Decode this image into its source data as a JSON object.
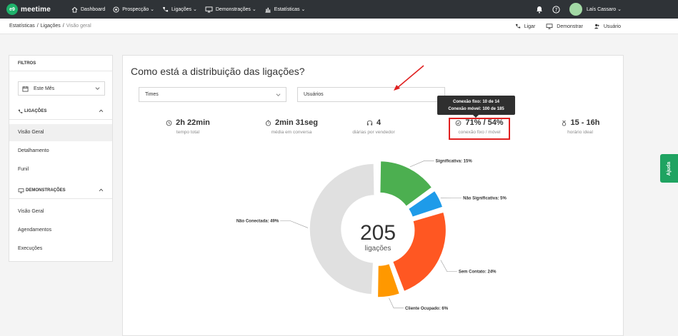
{
  "nav": {
    "logo_mark": "e9",
    "logo_text": "meetime",
    "items": [
      {
        "label": "Dashboard",
        "icon": "home-icon"
      },
      {
        "label": "Prospecção ⌄",
        "icon": "target-icon"
      },
      {
        "label": "Ligações ⌄",
        "icon": "phone-icon"
      },
      {
        "label": "Demonstrações ⌄",
        "icon": "monitor-icon"
      },
      {
        "label": "Estatísticas ⌄",
        "icon": "bar-chart-icon"
      }
    ],
    "user_name": "Laís Cassaro ⌄"
  },
  "breadcrumb": {
    "items": [
      "Estatísticas",
      "/",
      "Ligações",
      "/",
      "Visão geral"
    ]
  },
  "crumb_actions": [
    {
      "label": "Ligar",
      "icon": "phone-icon"
    },
    {
      "label": "Demonstrar",
      "icon": "monitor-icon"
    },
    {
      "label": "Usuário",
      "icon": "user-icon"
    }
  ],
  "sidebar": {
    "filters_title": "FILTROS",
    "period": "Este Mês",
    "group1": "LIGAÇÕES",
    "group1_items": [
      "Visão Geral",
      "Detalhamento",
      "Funil"
    ],
    "group2": "DEMONSTRAÇÕES",
    "group2_items": [
      "Visão Geral",
      "Agendamentos",
      "Execuções"
    ]
  },
  "main": {
    "title": "Como está a distribuição das ligações?",
    "select_teams": "Times",
    "select_users": "Usuários",
    "stats": [
      {
        "value": "2h 22min",
        "label": "tempo total",
        "icon": "history-icon"
      },
      {
        "value": "2min 31seg",
        "label": "média em conversa",
        "icon": "stopwatch-icon"
      },
      {
        "value": "4",
        "label": "diárias por vendedor",
        "icon": "headset-icon"
      },
      {
        "value": "71% / 54%",
        "label": "conexão fixo / móvel",
        "icon": "check-circle-icon"
      },
      {
        "value": "15 - 16h",
        "label": "horário ideal",
        "icon": "medal-icon"
      }
    ],
    "tooltip_line1": "Conexão fixo: 10 de 14",
    "tooltip_line2": "Conexão móvel: 100 de 185"
  },
  "help_label": "Ajuda",
  "chart_data": {
    "type": "pie",
    "center_value": "205",
    "center_label": "ligações",
    "slices": [
      {
        "label": "Significativa: 15%",
        "value": 15,
        "color": "#4caf50"
      },
      {
        "label": "Não Significativa: 5%",
        "value": 5,
        "color": "#1e9be9"
      },
      {
        "label": "Sem Contato: 24%",
        "value": 24,
        "color": "#ff5722"
      },
      {
        "label": "Cliente Ocupado: 6%",
        "value": 6,
        "color": "#ff9800"
      },
      {
        "label": "Não Conectada: 49%",
        "value": 49,
        "color": "#e0e0e0"
      }
    ]
  }
}
